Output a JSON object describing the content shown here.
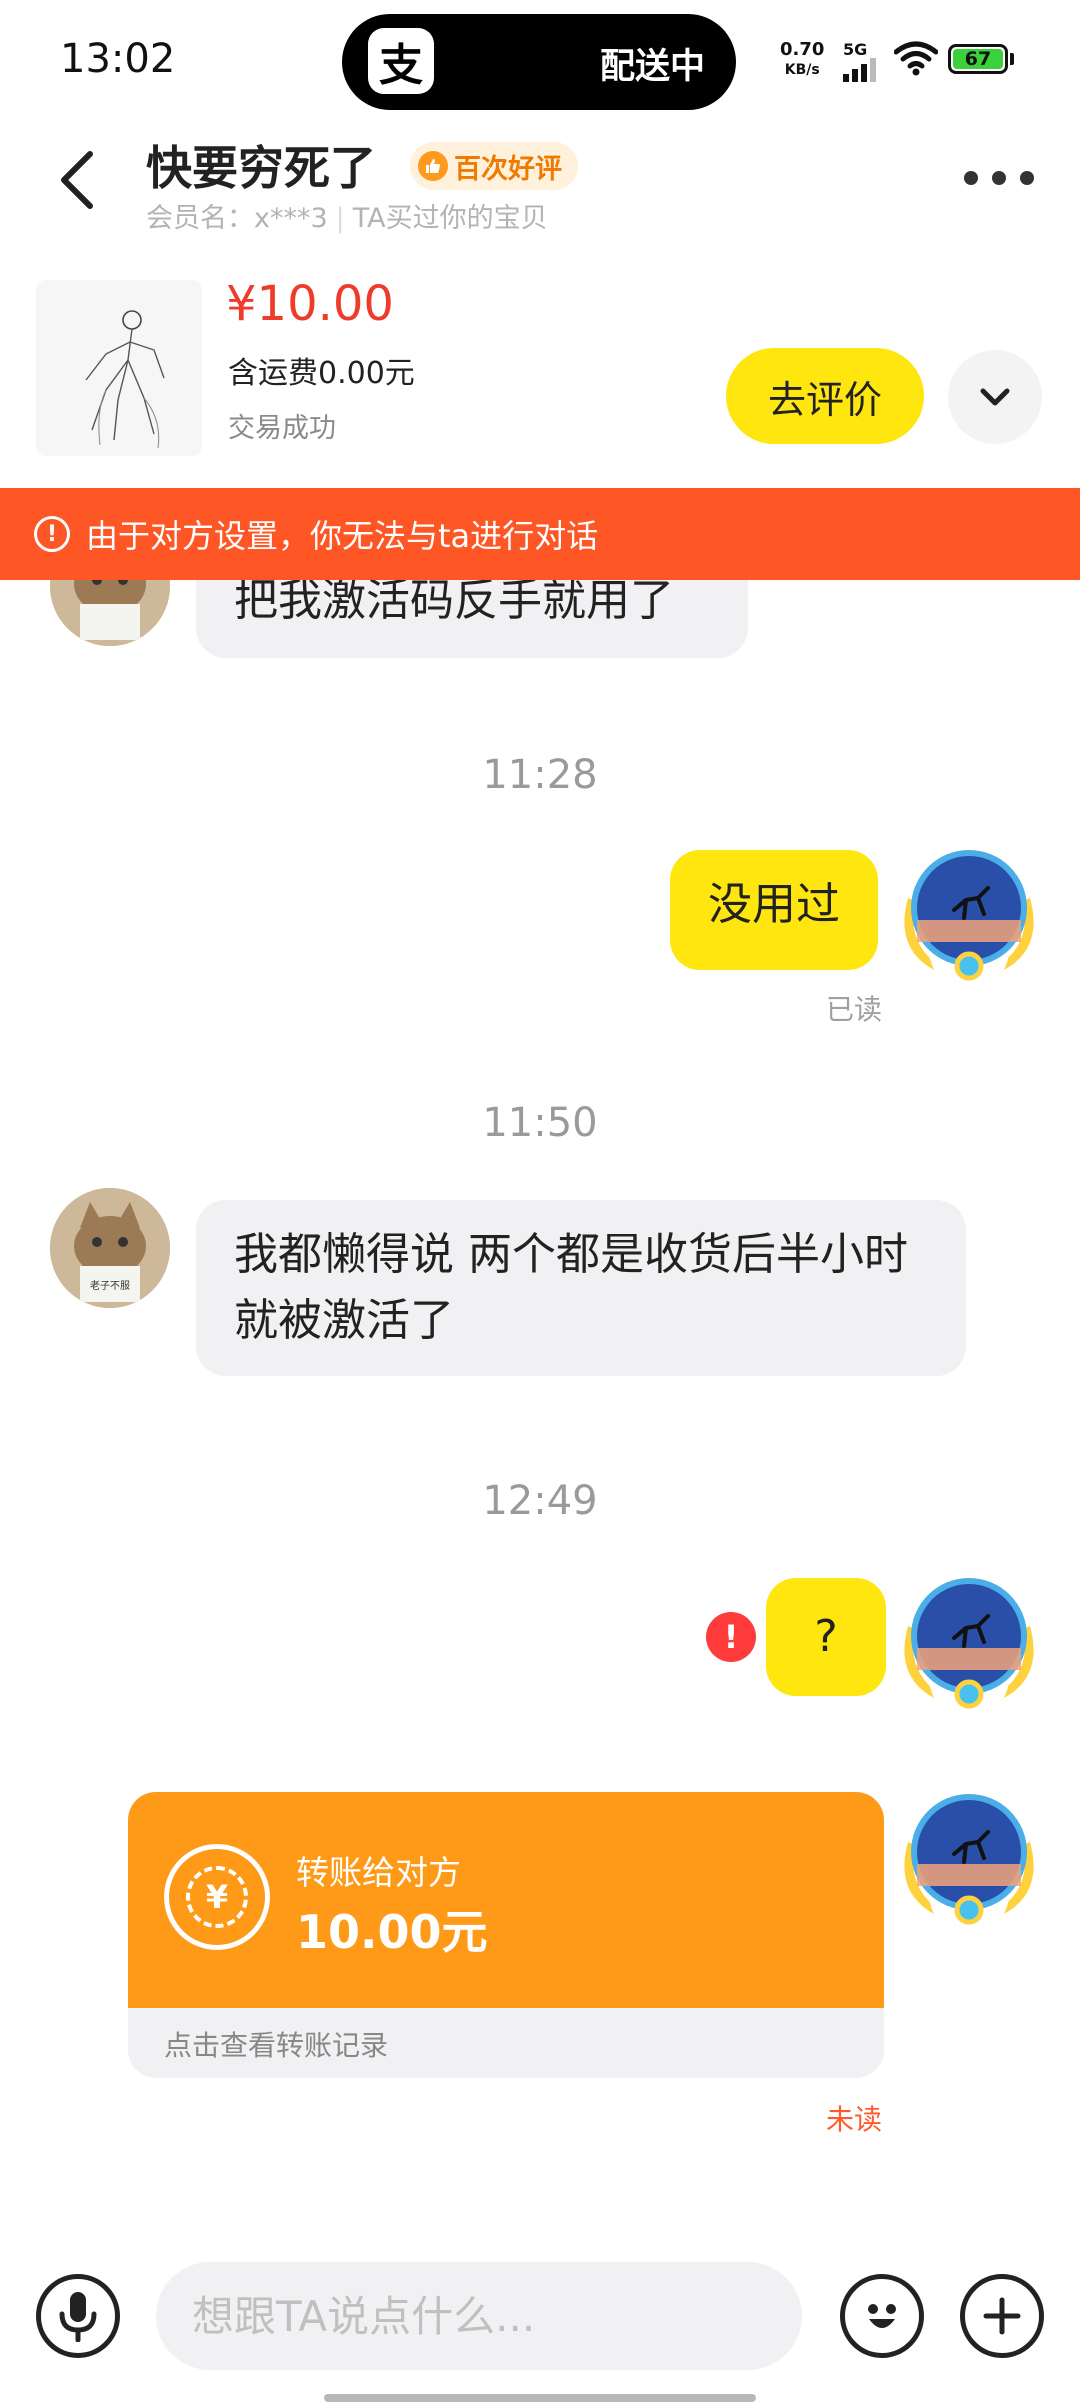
{
  "status_bar": {
    "time": "13:02",
    "app_badge": "支",
    "island_text": "配送中",
    "net_speed_value": "0.70",
    "net_speed_unit": "KB/s",
    "network": "5G",
    "battery": "67"
  },
  "header": {
    "title": "快要穷死了",
    "badge": "百次好评",
    "member_label": "会员名：x***3",
    "member_note": "TA买过你的宝贝"
  },
  "product": {
    "price": "¥10.00",
    "shipping": "含运费0.00元",
    "status": "交易成功",
    "review_button": "去评价"
  },
  "warning": {
    "icon": "!",
    "text": "由于对方设置，你无法与ta进行对话"
  },
  "messages": {
    "m1": "把我激活码反手就用了",
    "t1": "11:28",
    "m2": "没用过",
    "m2_status": "已读",
    "t2": "11:50",
    "m3": "我都懒得说  两个都是收货后半小时就被激活了",
    "t3": "12:49",
    "m4": "?",
    "m4_fail_icon": "!"
  },
  "transfer": {
    "title": "转账给对方",
    "amount": "10.00元",
    "footer": "点击查看转账记录",
    "status": "未读",
    "coin_symbol": "¥"
  },
  "input_bar": {
    "placeholder": "想跟TA说点什么..."
  },
  "colors": {
    "accent_yellow": "#ffe60f",
    "warning_orange": "#ff5626",
    "transfer_orange": "#ff9a18",
    "price_red": "#ef3b2b"
  },
  "cat_sign": "老子不服"
}
